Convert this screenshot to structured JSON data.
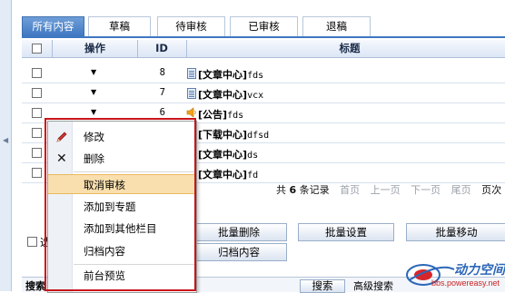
{
  "tabs": [
    "所有内容",
    "草稿",
    "待审核",
    "已审核",
    "退稿"
  ],
  "table": {
    "headers": {
      "op": "操作",
      "id": "ID",
      "title": "标题"
    },
    "rows": [
      {
        "id": "8",
        "category": "[文章中心]",
        "text": "fds",
        "icon": "document-icon"
      },
      {
        "id": "7",
        "category": "[文章中心]",
        "text": "vcx",
        "icon": "document-icon"
      },
      {
        "id": "6",
        "category": "[公告]",
        "text": "fds",
        "icon": "speaker-icon"
      },
      {
        "id": "",
        "category": "[下载中心]",
        "text": "dfsd",
        "icon": "download-icon"
      },
      {
        "id": "",
        "category": "[文章中心]",
        "text": "ds",
        "icon": "document-icon"
      },
      {
        "id": "",
        "category": "[文章中心]",
        "text": "fd",
        "icon": "document-icon"
      }
    ]
  },
  "pager": {
    "prefix": "共",
    "count": "6",
    "suffix": "条记录",
    "first": "首页",
    "prev": "上一页",
    "next": "下一页",
    "last": "尾页",
    "jump": "页次"
  },
  "buttons": {
    "batch_delete": "批量删除",
    "batch_settings": "批量设置",
    "batch_move": "批量移动",
    "archive": "归档内容",
    "select_all_partial": "选"
  },
  "context_menu": {
    "items": [
      {
        "label": "修改",
        "icon": "pencil-icon"
      },
      {
        "label": "删除",
        "icon": "delete-x-icon"
      },
      {
        "label": "取消审核",
        "highlighted": true
      },
      {
        "label": "添加到专题"
      },
      {
        "label": "添加到其他栏目"
      },
      {
        "label": "归档内容"
      },
      {
        "label": "前台预览"
      }
    ]
  },
  "bottom": {
    "search_partial": "搜索",
    "search_btn": "搜索",
    "advanced_partial": "高级搜索"
  },
  "watermark": {
    "brand": "动力空间",
    "url": "bbs.powereasy.net"
  },
  "colors": {
    "accent": "#3f77c1",
    "highlight": "#f9dfae",
    "annotation": "#c8141b"
  }
}
